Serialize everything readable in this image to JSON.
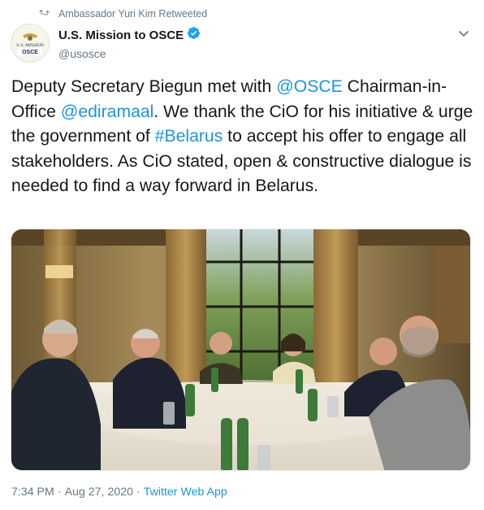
{
  "retweet": {
    "label": "Ambassador Yuri Kim Retweeted",
    "icon": "retweet-icon"
  },
  "author": {
    "display_name": "U.S. Mission to OSCE",
    "handle": "@usosce",
    "verified": true,
    "verified_color": "#1da1f2",
    "avatar_text_top": "U.S. MISSION",
    "avatar_text_bottom": "OSCE"
  },
  "tweet": {
    "segments": [
      {
        "text": "Deputy Secretary Biegun met with ",
        "link": false
      },
      {
        "text": "@OSCE",
        "link": true
      },
      {
        "text": " Chairman-in-Office ",
        "link": false
      },
      {
        "text": "@ediramaal",
        "link": true
      },
      {
        "text": ". We thank the CiO for his initiative & urge the government of ",
        "link": false
      },
      {
        "text": "#Belarus",
        "link": true
      },
      {
        "text": " to accept his offer to engage all stakeholders. As CiO stated, open & constructive dialogue is needed to find a way forward in Belarus.",
        "link": false
      }
    ],
    "link_color": "#1b95e0"
  },
  "meta": {
    "time": "7:34 PM",
    "separator1": "·",
    "date": "Aug 27, 2020",
    "separator2": "·",
    "source": "Twitter Web App"
  }
}
